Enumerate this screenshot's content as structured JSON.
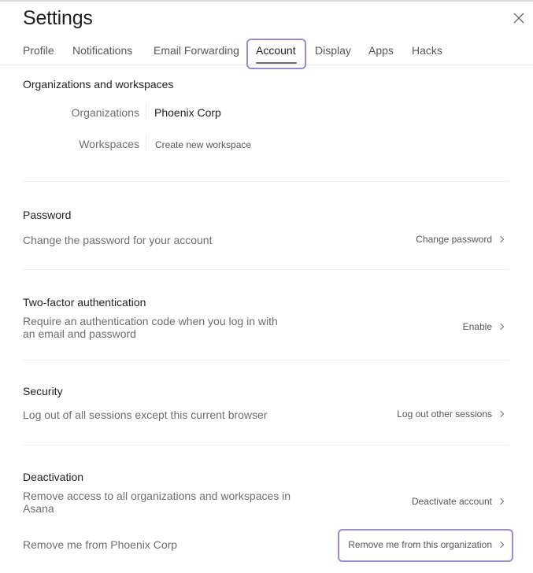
{
  "header": {
    "title": "Settings",
    "close_icon": "close-icon"
  },
  "tabs": [
    {
      "label": "Profile",
      "active": false
    },
    {
      "label": "Notifications",
      "active": false
    },
    {
      "label": "Email Forwarding",
      "active": false
    },
    {
      "label": "Account",
      "active": true
    },
    {
      "label": "Display",
      "active": false
    },
    {
      "label": "Apps",
      "active": false
    },
    {
      "label": "Hacks",
      "active": false
    }
  ],
  "orgs_section": {
    "heading": "Organizations and workspaces",
    "organizations_label": "Organizations",
    "organizations_value": "Phoenix Corp",
    "workspaces_label": "Workspaces",
    "workspaces_action": "Create new workspace"
  },
  "password": {
    "heading": "Password",
    "description": "Change the password for your account",
    "action": "Change password"
  },
  "two_factor": {
    "heading": "Two-factor authentication",
    "description_line1": "Require an authentication code when you log in with",
    "description_line2": "an email and password",
    "action": "Enable"
  },
  "security": {
    "heading": "Security",
    "description": "Log out of all sessions except this current browser",
    "action": "Log out other sessions"
  },
  "deactivation": {
    "heading": "Deactivation",
    "description_line1": "Remove access to all organizations and workspaces in",
    "description_line2": "Asana",
    "action": "Deactivate account",
    "remove_description": "Remove me from Phoenix Corp",
    "remove_action": "Remove me from this organization"
  },
  "colors": {
    "focus_ring": "#9f87d9",
    "text_primary": "#1e1f21",
    "text_secondary": "#6d6e6f"
  }
}
